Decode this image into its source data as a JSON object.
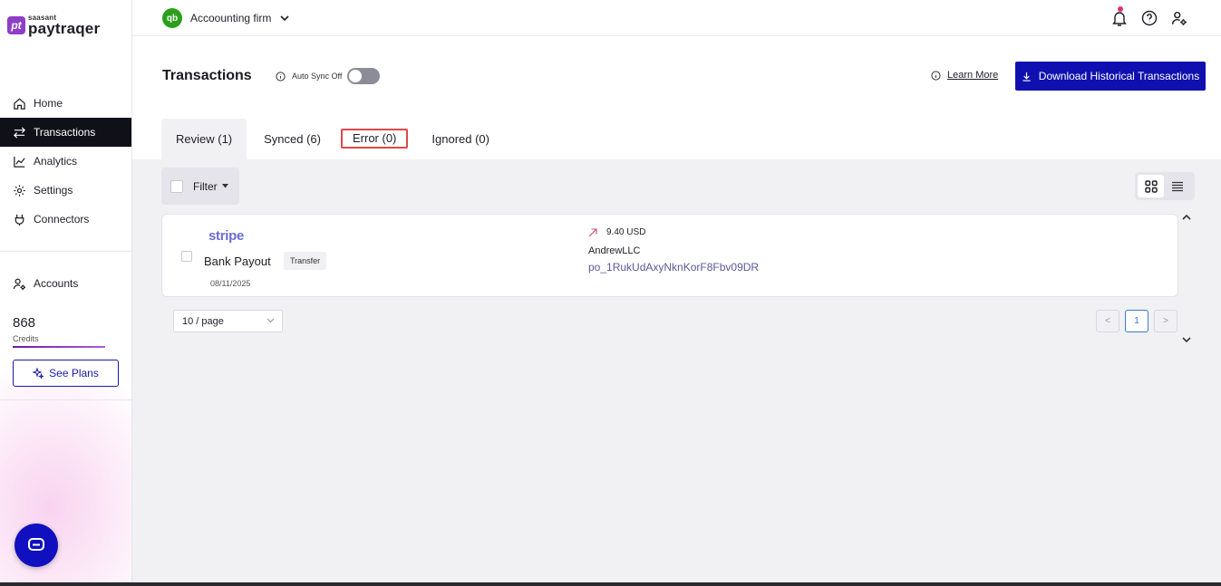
{
  "brand": {
    "small": "saasant",
    "name": "paytraqer",
    "mark": "pt"
  },
  "nav": {
    "items": [
      {
        "label": "Home",
        "icon": "home-icon"
      },
      {
        "label": "Transactions",
        "icon": "transfer-arrows-icon",
        "active": true
      },
      {
        "label": "Analytics",
        "icon": "line-chart-icon"
      },
      {
        "label": "Settings",
        "icon": "gear-icon"
      },
      {
        "label": "Connectors",
        "icon": "plug-icon"
      }
    ],
    "accounts_label": "Accounts"
  },
  "credits": {
    "value": "868",
    "label": "Credits"
  },
  "see_plans_label": "See Plans",
  "topbar": {
    "qb_mark": "qb",
    "company": "Accoounting firm"
  },
  "header": {
    "title": "Transactions",
    "auto_sync": "Auto Sync Off",
    "learn_more": "Learn More",
    "download": "Download Historical Transactions"
  },
  "tabs": [
    "Review (1)",
    "Synced (6)",
    "Error (0)",
    "Ignored (0)"
  ],
  "filter_label": "Filter",
  "transaction": {
    "source": "stripe",
    "title": "Bank Payout",
    "type": "Transfer",
    "date": "08/11/2025",
    "amount": "9.40 USD",
    "vendor": "AndrewLLC",
    "ref": "po_1RukUdAxyNknKorF8Fbv09DR"
  },
  "pagination": {
    "page_size": "10 / page",
    "current": "1",
    "prev": "<",
    "next": ">"
  },
  "colors": {
    "accent": "#1010b0",
    "active_nav": "#101018",
    "error_outline": "#e04848",
    "qb_green": "#2ca01c"
  }
}
